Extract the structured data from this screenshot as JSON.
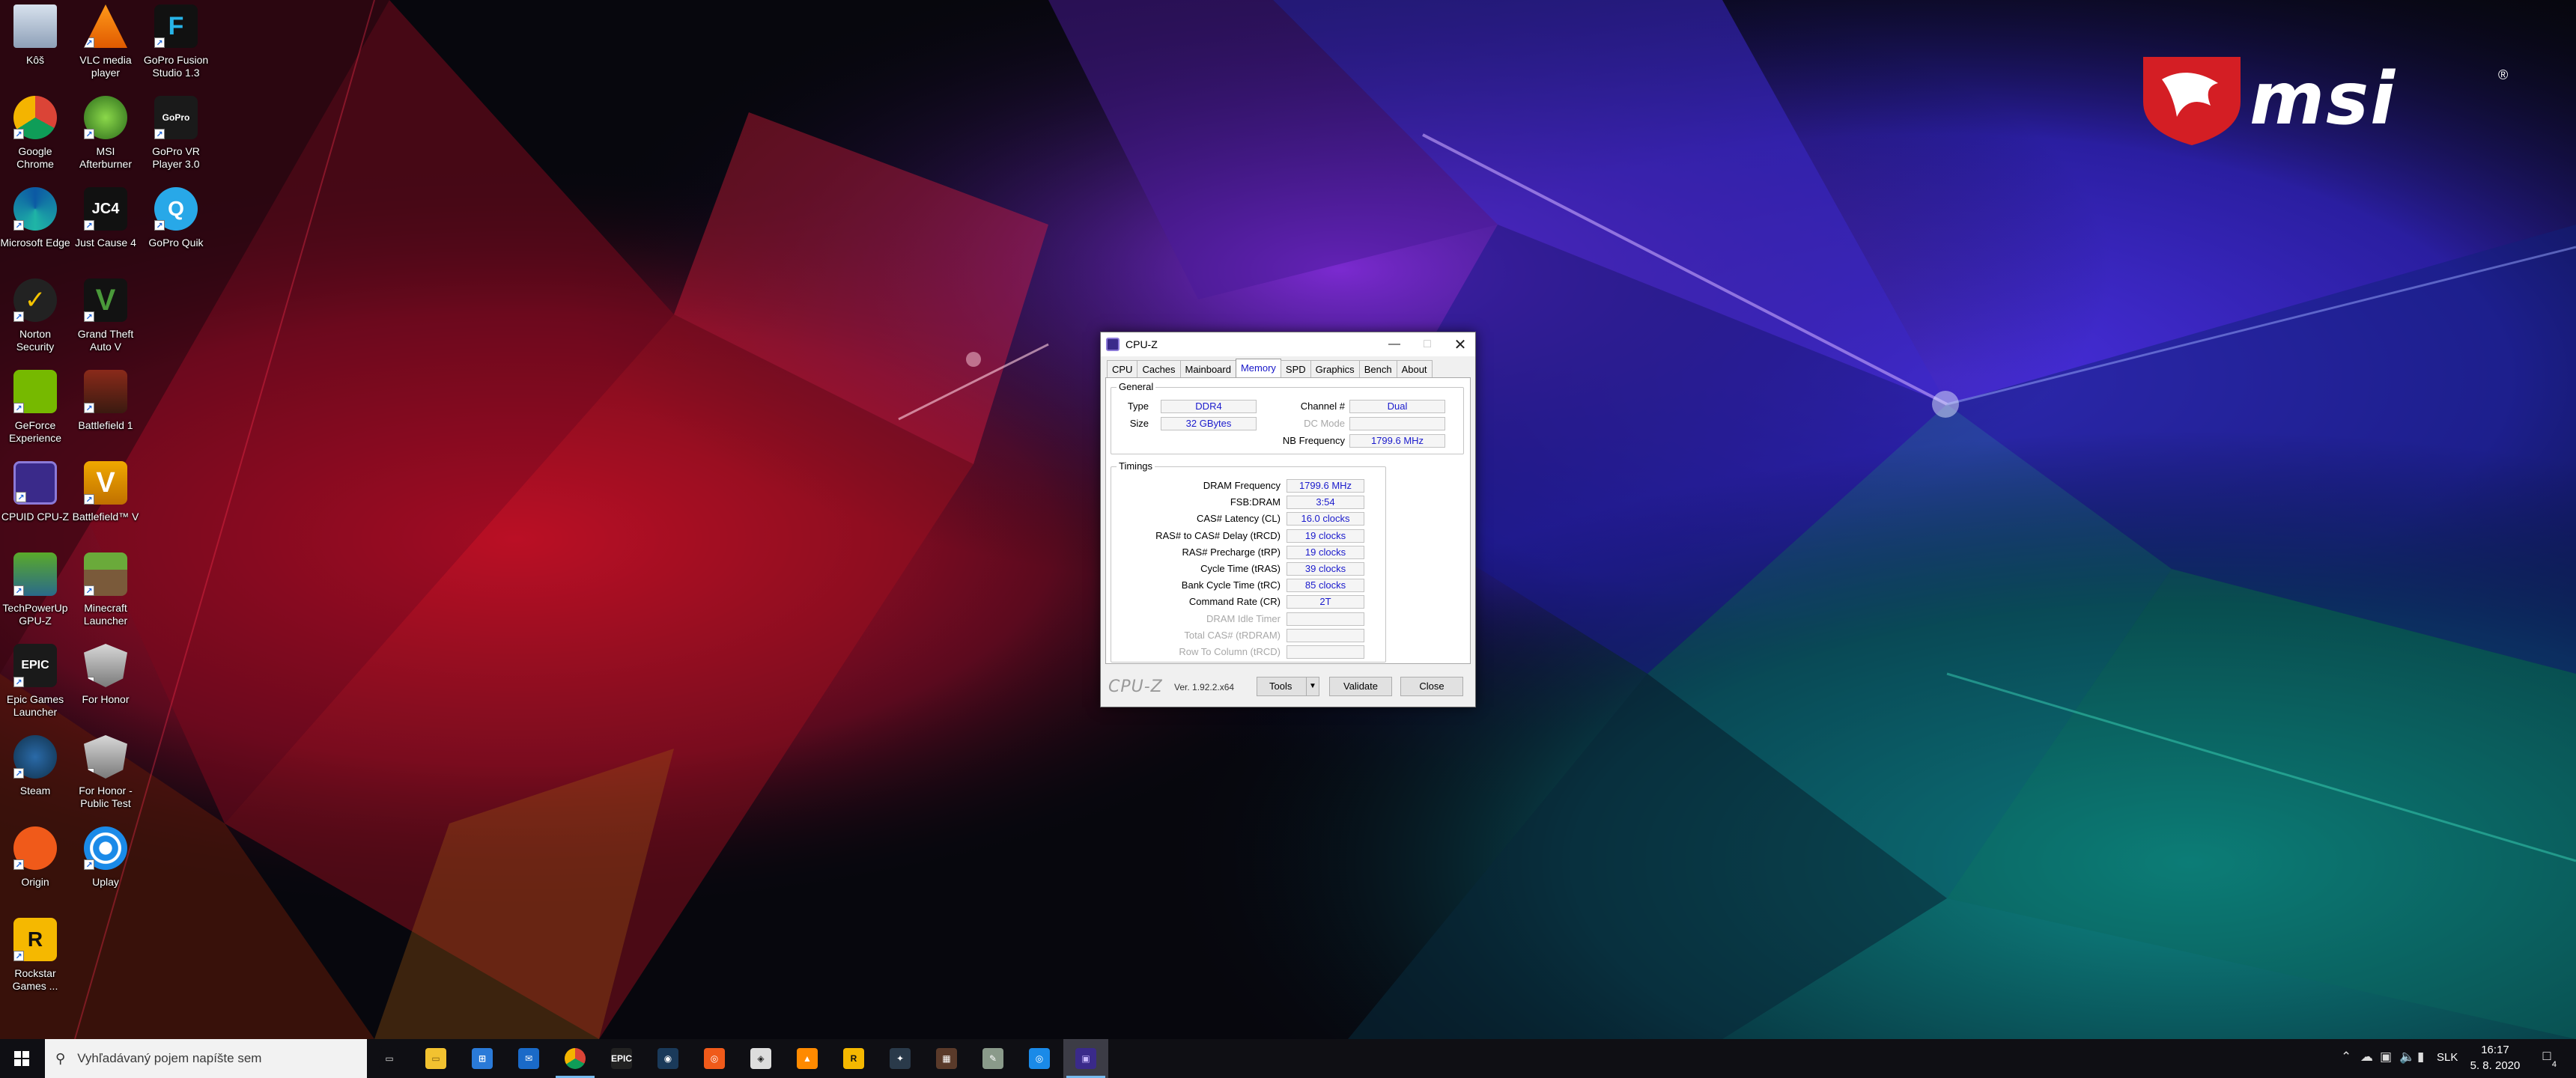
{
  "desktop": {
    "icons": [
      {
        "label": "Kôš",
        "icon": "recycle-bin-icon"
      },
      {
        "label": "VLC media player",
        "icon": "vlc-icon"
      },
      {
        "label": "GoPro Fusion Studio 1.3",
        "icon": "gopro-fusion-icon"
      },
      {
        "label": "Google Chrome",
        "icon": "chrome-icon"
      },
      {
        "label": "MSI Afterburner",
        "icon": "msi-afterburner-icon"
      },
      {
        "label": "GoPro VR Player 3.0",
        "icon": "gopro-vr-icon"
      },
      {
        "label": "Microsoft Edge",
        "icon": "edge-icon"
      },
      {
        "label": "Just Cause 4",
        "icon": "just-cause-icon"
      },
      {
        "label": "GoPro Quik",
        "icon": "gopro-quik-icon"
      },
      {
        "label": "Norton Security",
        "icon": "norton-icon"
      },
      {
        "label": "Grand Theft Auto V",
        "icon": "gta-icon"
      },
      {
        "label": "GeForce Experience",
        "icon": "geforce-icon"
      },
      {
        "label": "Battlefield 1",
        "icon": "battlefield1-icon"
      },
      {
        "label": "CPUID CPU-Z",
        "icon": "cpuz-icon"
      },
      {
        "label": "Battlefield™ V",
        "icon": "battlefieldv-icon"
      },
      {
        "label": "TechPowerUp GPU-Z",
        "icon": "gpuz-icon"
      },
      {
        "label": "Minecraft Launcher",
        "icon": "minecraft-icon"
      },
      {
        "label": "Epic Games Launcher",
        "icon": "epic-icon"
      },
      {
        "label": "For Honor",
        "icon": "forhonor-icon"
      },
      {
        "label": "Steam",
        "icon": "steam-icon"
      },
      {
        "label": "For Honor - Public Test",
        "icon": "forhonor-test-icon"
      },
      {
        "label": "Origin",
        "icon": "origin-icon"
      },
      {
        "label": "Uplay",
        "icon": "uplay-icon"
      },
      {
        "label": "Rockstar Games ...",
        "icon": "rockstar-icon"
      }
    ]
  },
  "wallpaper": {
    "brand": "msi",
    "registered": "®"
  },
  "cpuz": {
    "title": "CPU-Z",
    "tabs": [
      "CPU",
      "Caches",
      "Mainboard",
      "Memory",
      "SPD",
      "Graphics",
      "Bench",
      "About"
    ],
    "active_tab": "Memory",
    "general": {
      "legend": "General",
      "type_label": "Type",
      "type_value": "DDR4",
      "size_label": "Size",
      "size_value": "32 GBytes",
      "channel_label": "Channel #",
      "channel_value": "Dual",
      "dc_mode_label": "DC Mode",
      "dc_mode_value": "",
      "nb_freq_label": "NB Frequency",
      "nb_freq_value": "1799.6 MHz"
    },
    "timings": {
      "legend": "Timings",
      "rows": [
        {
          "label": "DRAM Frequency",
          "value": "1799.6 MHz",
          "enabled": true
        },
        {
          "label": "FSB:DRAM",
          "value": "3:54",
          "enabled": true
        },
        {
          "label": "CAS# Latency (CL)",
          "value": "16.0 clocks",
          "enabled": true
        },
        {
          "label": "RAS# to CAS# Delay (tRCD)",
          "value": "19 clocks",
          "enabled": true
        },
        {
          "label": "RAS# Precharge (tRP)",
          "value": "19 clocks",
          "enabled": true
        },
        {
          "label": "Cycle Time (tRAS)",
          "value": "39 clocks",
          "enabled": true
        },
        {
          "label": "Bank Cycle Time (tRC)",
          "value": "85 clocks",
          "enabled": true
        },
        {
          "label": "Command Rate (CR)",
          "value": "2T",
          "enabled": true
        },
        {
          "label": "DRAM Idle Timer",
          "value": "",
          "enabled": false
        },
        {
          "label": "Total CAS# (tRDRAM)",
          "value": "",
          "enabled": false
        },
        {
          "label": "Row To Column (tRCD)",
          "value": "",
          "enabled": false
        }
      ]
    },
    "footer": {
      "logo": "CPU-Z",
      "version": "Ver. 1.92.2.x64",
      "tools_label": "Tools",
      "validate_label": "Validate",
      "close_label": "Close"
    }
  },
  "taskbar": {
    "search_placeholder": "Vyhľadávaný pojem napíšte sem",
    "apps": [
      "task-view",
      "file-explorer",
      "microsoft-store",
      "mail",
      "chrome",
      "epic-games",
      "steam",
      "origin",
      "msi-app",
      "vlc",
      "rockstar",
      "app-dark",
      "gpuz",
      "paint-app",
      "uplay",
      "cpuz"
    ],
    "tray": {
      "language": "SLK",
      "time": "16:17",
      "date": "5. 8. 2020",
      "notification_count": "4"
    }
  }
}
